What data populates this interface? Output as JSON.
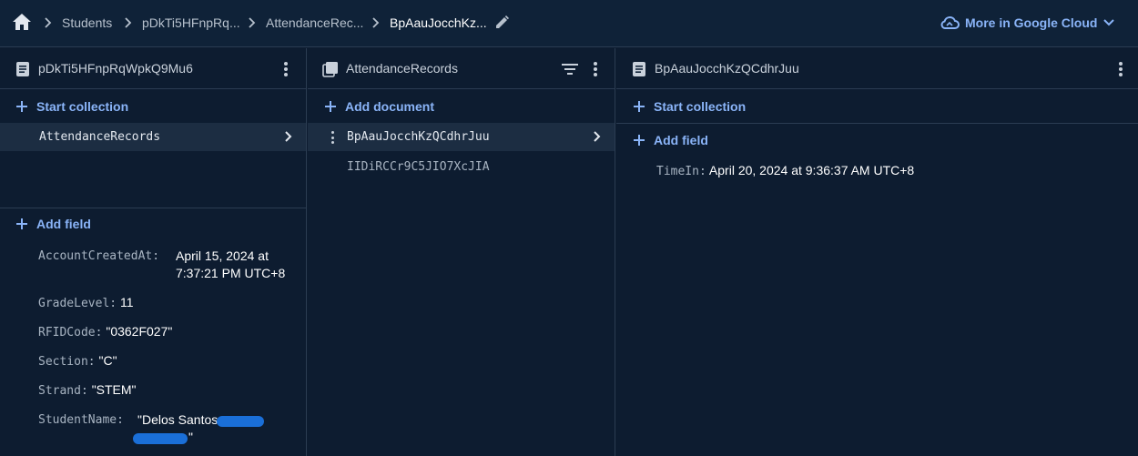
{
  "breadcrumb": {
    "items": [
      "Students",
      "pDkTi5HFnpRq...",
      "AttendanceRec...",
      "BpAauJocchKz..."
    ],
    "cloud_link": "More in Google Cloud"
  },
  "icons": {
    "home": "home-icon",
    "separator": "chevron-right-icon",
    "edit": "pencil-icon",
    "cloud": "cloud-icon",
    "expand": "chevron-down-icon",
    "document": "document-icon",
    "collection": "collection-icon",
    "filter": "filter-icon",
    "more": "more-vert-icon",
    "add": "plus-icon"
  },
  "colors": {
    "background": "#0d1c30",
    "accent": "#8ab4f8",
    "selected": "#1c2d42"
  },
  "panel1": {
    "title": "pDkTi5HFnpRqWpkQ9Mu6",
    "start_collection": "Start collection",
    "collections": [
      "AttendanceRecords"
    ],
    "add_field": "Add field",
    "fields": [
      {
        "key": "AccountCreatedAt:",
        "value_line1": "April 15, 2024 at",
        "value_line2": "7:37:21 PM UTC+8"
      },
      {
        "key": "GradeLevel:",
        "value": "11"
      },
      {
        "key": "RFIDCode:",
        "value": "\"0362F027\""
      },
      {
        "key": "Section:",
        "value": "\"C\""
      },
      {
        "key": "Strand:",
        "value": "\"STEM\""
      },
      {
        "key": "StudentName:",
        "value_line1": "\"Delos Santos",
        "value_line2": "\""
      }
    ]
  },
  "panel2": {
    "title": "AttendanceRecords",
    "add_document": "Add document",
    "documents": [
      "BpAauJocchKzQCdhrJuu",
      "IIDiRCCr9C5JIO7XcJIA"
    ]
  },
  "panel3": {
    "title": "BpAauJocchKzQCdhrJuu",
    "start_collection": "Start collection",
    "add_field": "Add field",
    "fields": [
      {
        "key": "TimeIn:",
        "value": "April 20, 2024 at 9:36:37 AM UTC+8"
      }
    ]
  }
}
